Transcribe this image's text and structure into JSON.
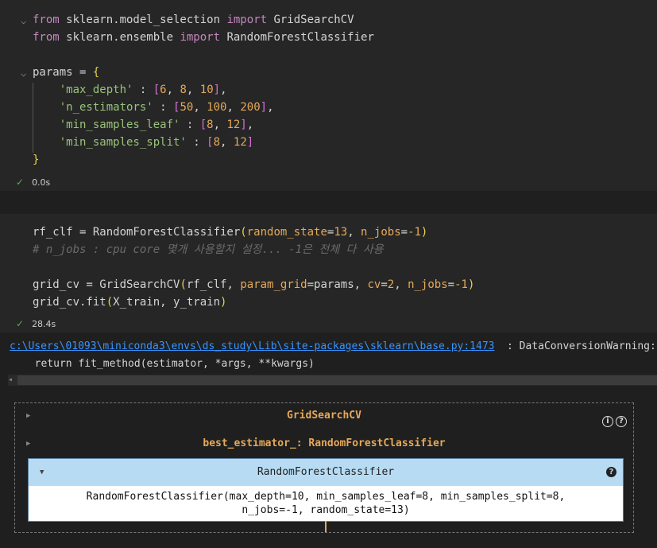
{
  "cell1": {
    "lines": {
      "l1_kw1": "from",
      "l1_mod": " sklearn.model_selection ",
      "l1_kw2": "import",
      "l1_name": " GridSearchCV",
      "l2_kw1": "from",
      "l2_mod": " sklearn.ensemble ",
      "l2_kw2": "import",
      "l2_name": " RandomForestClassifier",
      "l3_var": "params = ",
      "l3_brace": "{",
      "p1_key": "'max_depth'",
      "p1_sep": " : ",
      "p1_vals": [
        "6",
        "8",
        "10"
      ],
      "p2_key": "'n_estimators'",
      "p2_sep": " : ",
      "p2_vals": [
        "50",
        "100",
        "200"
      ],
      "p3_key": "'min_samples_leaf'",
      "p3_sep": " : ",
      "p3_vals": [
        "8",
        "12"
      ],
      "p4_key": "'min_samples_split'",
      "p4_sep": " : ",
      "p4_vals": [
        "8",
        "12"
      ],
      "close": "}"
    },
    "status": "0.0s"
  },
  "cell2": {
    "l1_pre": "rf_clf = RandomForestClassifier",
    "l1_p1": "random_state",
    "l1_v1": "13",
    "l1_p2": "n_jobs",
    "l1_v2": "-1",
    "comment": "# n_jobs : cpu core 몇개 사용할지 설정... -1은 전체 다 사용",
    "l3_pre": "grid_cv = GridSearchCV",
    "l3_a1": "rf_clf",
    "l3_p1": "param_grid",
    "l3_v1": "params",
    "l3_p2": "cv",
    "l3_v2": "2",
    "l3_p3": "n_jobs",
    "l3_v3": "-1",
    "l4_pre": "grid_cv.fit",
    "l4_args": "X_train, y_train",
    "status": "28.4s"
  },
  "output": {
    "warning_link": "c:\\Users\\01093\\miniconda3\\envs\\ds_study\\Lib\\site-packages\\sklearn\\base.py:1473",
    "warning_text": ": DataConversionWarning:",
    "return_line": "  return fit_method(estimator, *args, **kwargs)",
    "estimator": {
      "outer_label": "GridSearchCV",
      "best_label": "best_estimator_: RandomForestClassifier",
      "inner_label": "RandomForestClassifier",
      "params_line1": "RandomForestClassifier(max_depth=10, min_samples_leaf=8, min_samples_split=8,",
      "params_line2": "n_jobs=-1, random_state=13)",
      "info_icon": "i",
      "help_icon": "?"
    }
  }
}
